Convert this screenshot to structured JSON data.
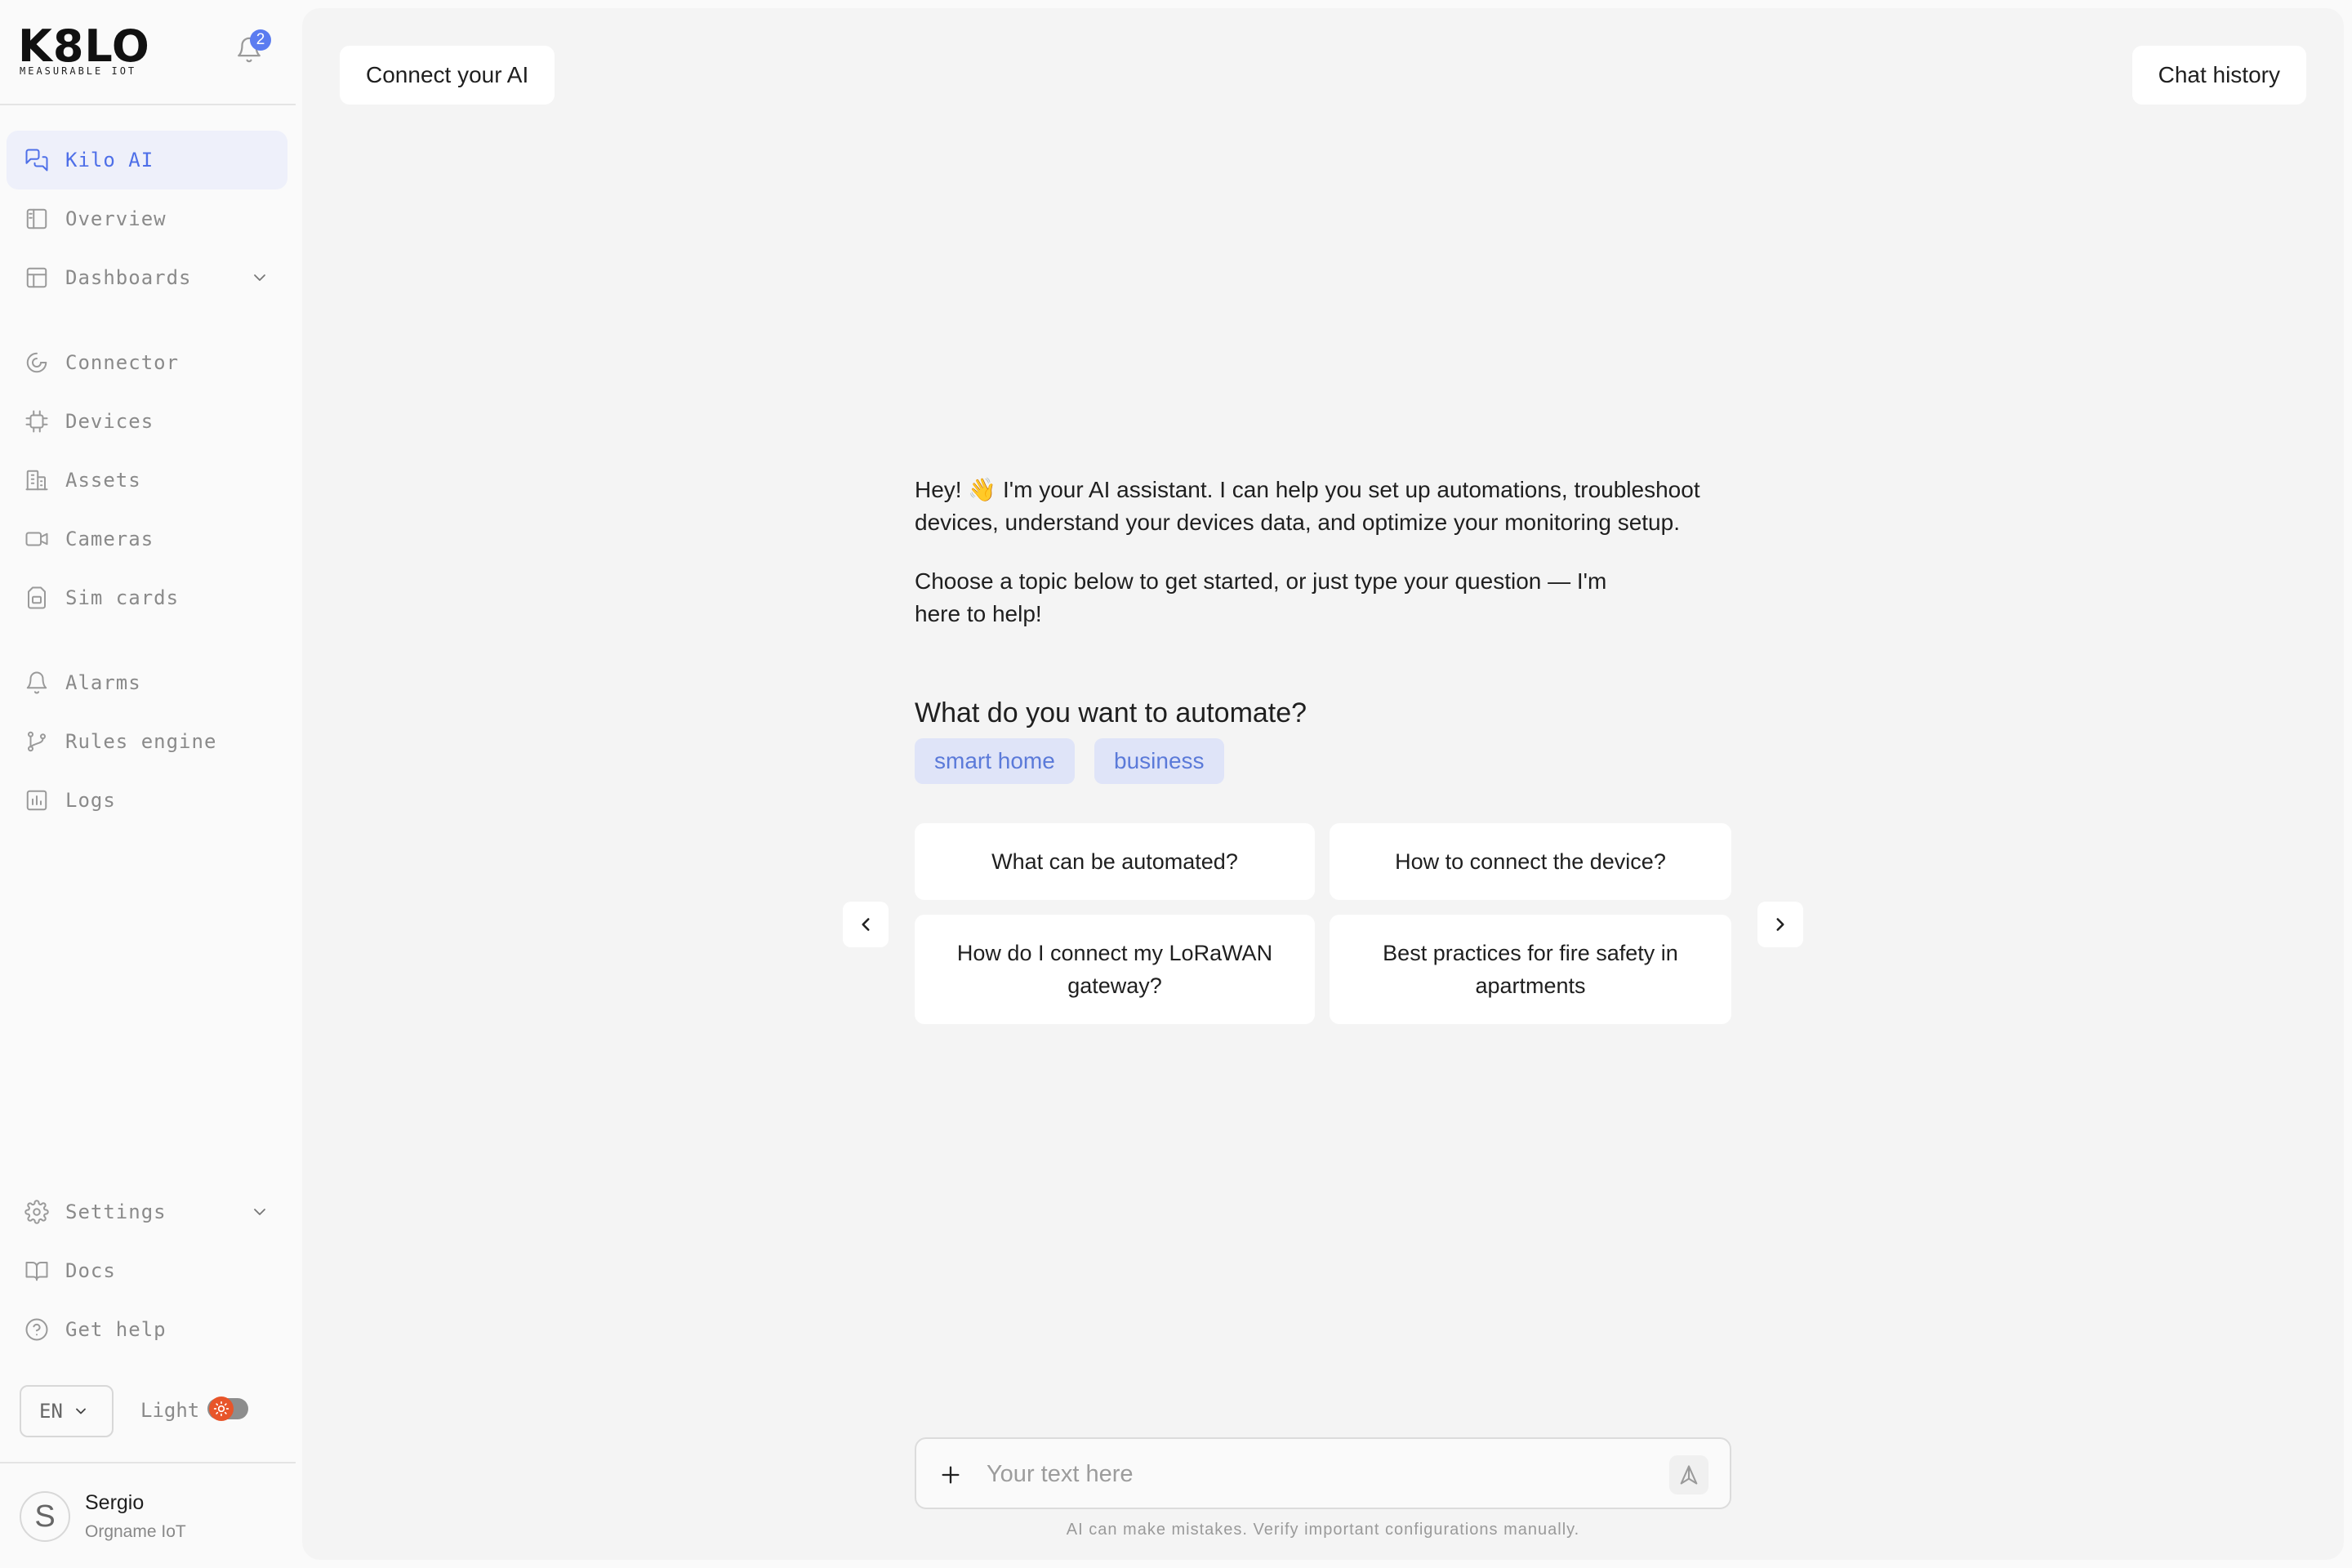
{
  "brand": {
    "logo": "K8LO",
    "tagline": "MEASURABLE IOT",
    "notifications_count": "2"
  },
  "sidebar": {
    "items": [
      {
        "label": "Kilo AI",
        "icon": "chat-icon",
        "active": true
      },
      {
        "label": "Overview",
        "icon": "book-panel-icon"
      },
      {
        "label": "Dashboards",
        "icon": "layout-icon",
        "expandable": true
      },
      {
        "label": "Connector",
        "icon": "connector-icon"
      },
      {
        "label": "Devices",
        "icon": "chip-icon"
      },
      {
        "label": "Assets",
        "icon": "building-icon"
      },
      {
        "label": "Cameras",
        "icon": "video-icon"
      },
      {
        "label": "Sim cards",
        "icon": "sim-card-icon"
      },
      {
        "label": "Alarms",
        "icon": "bell-icon"
      },
      {
        "label": "Rules engine",
        "icon": "git-branch-icon"
      },
      {
        "label": "Logs",
        "icon": "bar-chart-icon"
      },
      {
        "label": "Settings",
        "icon": "gear-icon",
        "expandable": true
      },
      {
        "label": "Docs",
        "icon": "open-book-icon"
      },
      {
        "label": "Get help",
        "icon": "help-circle-icon"
      }
    ],
    "language": "EN",
    "theme_label": "Light",
    "user": {
      "initial": "S",
      "name": "Sergio",
      "org": "Orgname IoT"
    }
  },
  "header": {
    "connect_label": "Connect your AI",
    "history_label": "Chat history"
  },
  "chat": {
    "intro_1": "Hey! 👋 I'm your AI assistant. I can help you set up automations, troubleshoot devices, understand your devices data, and optimize your monitoring setup.",
    "intro_2": "Choose a topic below to get started, or just type your question — I'm here to help!",
    "automate_question": "What do you want to automate?",
    "chips": [
      "smart home",
      "business"
    ],
    "suggestions": [
      "What can be automated?",
      "How to connect the device?",
      "How do I connect my LoRaWAN gateway?",
      "Best practices for fire safety in apartments"
    ],
    "input_placeholder": "Your text here",
    "disclaimer": "AI can make mistakes. Verify important configurations manually."
  },
  "colors": {
    "accent": "#5b7cf0",
    "active_bg": "#eef0fa",
    "chip_bg": "#dfe4f8",
    "toggle_sun": "#e8552a"
  }
}
